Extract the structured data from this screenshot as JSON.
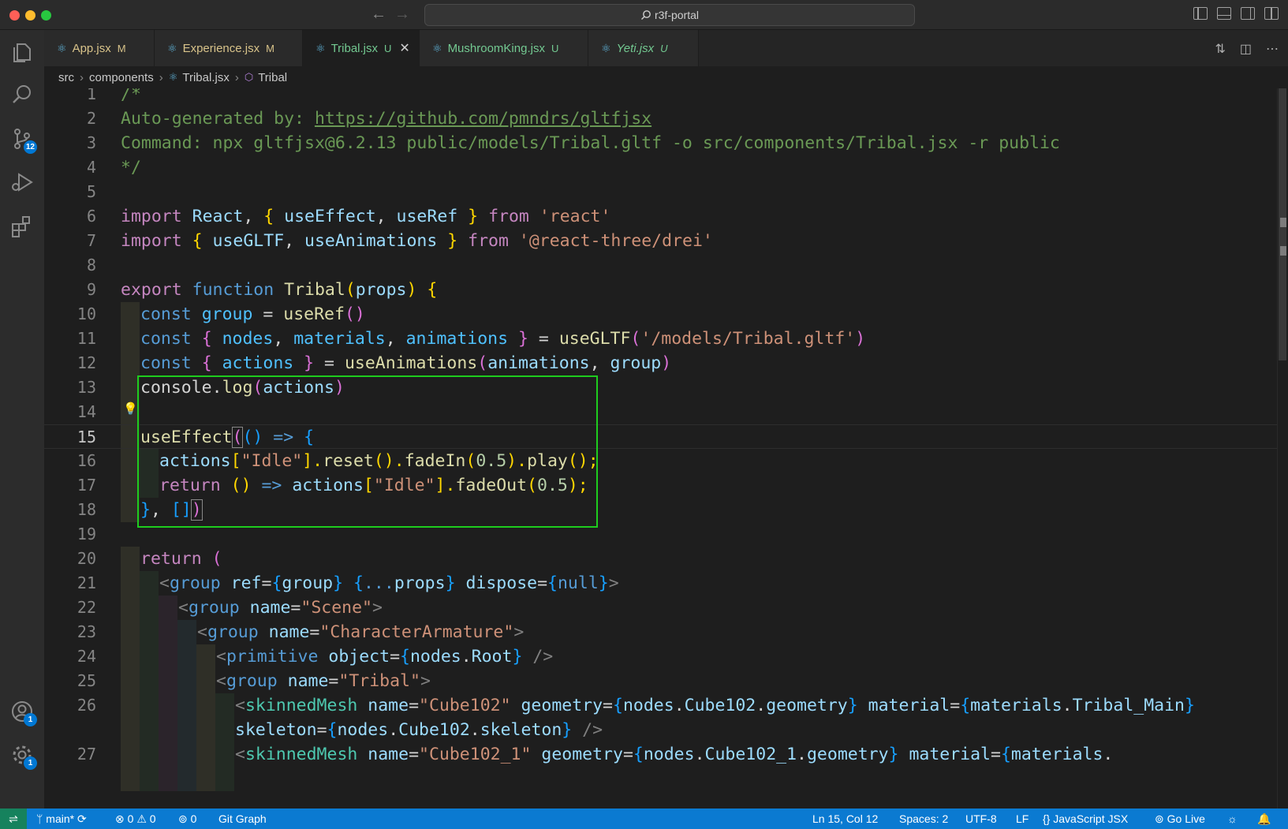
{
  "window": {
    "title": "r3f-portal"
  },
  "activity_bar": {
    "source_control_badge": "12",
    "accounts_badge": "1",
    "settings_badge": "1"
  },
  "tabs": [
    {
      "label": "App.jsx",
      "status": "M"
    },
    {
      "label": "Experience.jsx",
      "status": "M"
    },
    {
      "label": "Tribal.jsx",
      "status": "U",
      "active": true
    },
    {
      "label": "MushroomKing.jsx",
      "status": "U"
    },
    {
      "label": "Yeti.jsx",
      "status": "U"
    }
  ],
  "breadcrumb": [
    "src",
    "components",
    "Tribal.jsx",
    "Tribal"
  ],
  "editor": {
    "line_numbers": [
      "1",
      "2",
      "3",
      "4",
      "5",
      "6",
      "7",
      "8",
      "9",
      "10",
      "11",
      "12",
      "13",
      "14",
      "15",
      "16",
      "17",
      "18",
      "19",
      "20",
      "21",
      "22",
      "23",
      "24",
      "25",
      "26",
      "",
      "27"
    ],
    "lines": [
      [
        "/*"
      ],
      [
        "Auto-generated by: ",
        "https://github.com/pmndrs/gltfjsx"
      ],
      [
        "Command: npx gltfjsx@6.2.13 public/models/Tribal.gltf -o src/components/Tribal.jsx -r public"
      ],
      [
        "*/"
      ],
      [
        ""
      ],
      [
        "import",
        " ",
        "React",
        ", ",
        "{",
        " ",
        "useEffect",
        ", ",
        "useRef",
        " ",
        "}",
        " ",
        "from",
        " ",
        "'react'"
      ],
      [
        "import",
        " ",
        "{",
        " ",
        "useGLTF",
        ", ",
        "useAnimations",
        " ",
        "}",
        " ",
        "from",
        " ",
        "'@react-three/drei'"
      ],
      [
        ""
      ],
      [
        "export",
        " ",
        "function",
        " ",
        "Tribal",
        "(",
        "props",
        ")",
        " ",
        "{"
      ],
      [
        "const",
        " ",
        "group",
        " = ",
        "useRef",
        "()"
      ],
      [
        "const",
        " ",
        "{",
        " ",
        "nodes",
        ", ",
        "materials",
        ", ",
        "animations",
        " ",
        "}",
        " = ",
        "useGLTF",
        "(",
        "'/models/Tribal.gltf'",
        ")"
      ],
      [
        "const",
        " ",
        "{",
        " ",
        "actions",
        " ",
        "}",
        " = ",
        "useAnimations",
        "(",
        "animations",
        ", ",
        "group",
        ")"
      ],
      [
        "console",
        ".",
        "log",
        "(",
        "actions",
        ")"
      ],
      [
        ""
      ],
      [
        "useEffect",
        "(",
        "()",
        " ",
        "=>",
        " ",
        "{"
      ],
      [
        "actions",
        "[",
        "\"Idle\"",
        "].",
        "reset",
        "().",
        "fadeIn",
        "(",
        "0.5",
        ").",
        "play",
        "();"
      ],
      [
        "return",
        " ",
        "()",
        " ",
        "=>",
        " ",
        "actions",
        "[",
        "\"Idle\"",
        "].",
        "fadeOut",
        "(",
        "0.5",
        ");"
      ],
      [
        "}",
        ", ",
        "[]",
        ")"
      ],
      [
        ""
      ],
      [
        "return",
        " ",
        "("
      ],
      [
        "<",
        "group",
        " ",
        "ref",
        "=",
        "{",
        "group",
        "}",
        " ",
        "{",
        "...",
        "props",
        "}",
        " ",
        "dispose",
        "=",
        "{",
        "null",
        "}",
        ">"
      ],
      [
        "<",
        "group",
        " ",
        "name",
        "=",
        "\"Scene\"",
        ">"
      ],
      [
        "<",
        "group",
        " ",
        "name",
        "=",
        "\"CharacterArmature\"",
        ">"
      ],
      [
        "<",
        "primitive",
        " ",
        "object",
        "=",
        "{",
        "nodes",
        ".",
        "Root",
        "}",
        " />"
      ],
      [
        "<",
        "group",
        " ",
        "name",
        "=",
        "\"Tribal\"",
        ">"
      ],
      [
        "<",
        "skinnedMesh",
        " ",
        "name",
        "=",
        "\"Cube102\"",
        " ",
        "geometry",
        "=",
        "{",
        "nodes",
        ".",
        "Cube102",
        ".",
        "geometry",
        "}",
        " ",
        "material",
        "=",
        "{",
        "materials",
        ".",
        "Tribal_Main",
        "}"
      ],
      [
        "skeleton",
        "=",
        "{",
        "nodes",
        ".",
        "Cube102",
        ".",
        "skeleton",
        "}",
        " />"
      ],
      [
        "<",
        "skinnedMesh",
        " ",
        "name",
        "=",
        "\"Cube102_1\"",
        " ",
        "geometry",
        "=",
        "{",
        "nodes",
        ".",
        "Cube102_1",
        ".",
        "geometry",
        "}",
        " ",
        "material",
        "=",
        "{",
        "materials",
        "."
      ]
    ]
  },
  "statusbar": {
    "branch": "main*",
    "errors": "0",
    "warnings": "0",
    "ports": "0",
    "git_graph": "Git Graph",
    "cursor": "Ln 15, Col 12",
    "spaces": "Spaces: 2",
    "encoding": "UTF-8",
    "eol": "LF",
    "language": "JavaScript JSX",
    "go_live": "Go Live"
  },
  "colors": {
    "accent": "#0b7ad1",
    "highlight_box": "#1ecc1e",
    "modified": "#d8c38a",
    "untracked": "#73c991"
  },
  "icons": [
    "explorer-icon",
    "search-icon",
    "source-control-icon",
    "run-debug-icon",
    "extensions-icon",
    "accounts-icon",
    "settings-icon",
    "react-file-icon",
    "symbol-icon",
    "lightbulb-icon",
    "branch-icon",
    "sync-icon",
    "error-icon",
    "warning-icon",
    "broadcast-icon",
    "bell-icon"
  ]
}
